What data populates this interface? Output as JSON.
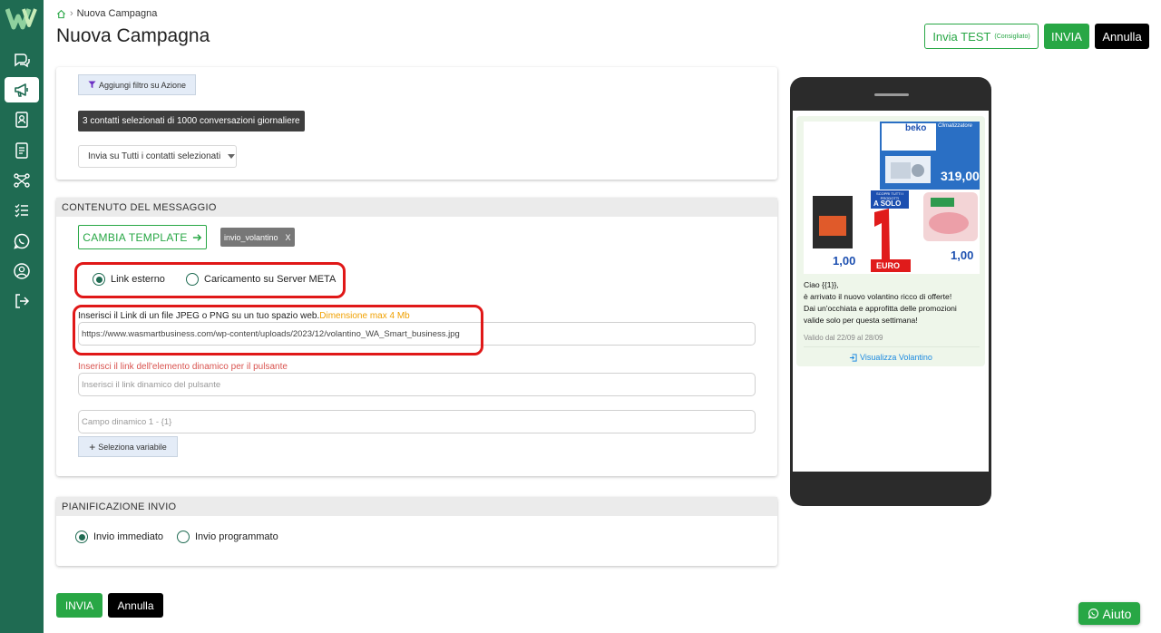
{
  "breadcrumb": {
    "current": "Nuova Campagna"
  },
  "page": {
    "title": "Nuova Campagna"
  },
  "header_actions": {
    "test_label": "Invia TEST",
    "test_hint": "(Consigliato)",
    "send_label": "INVIA",
    "cancel_label": "Annulla"
  },
  "filter_card": {
    "filter_button": "Aggiungi filtro su Azione",
    "contacts_badge": "3 contatti selezionati di 1000 conversazioni giornaliere",
    "send_select_value": "Invia su Tutti i contatti selezionati"
  },
  "content_card": {
    "heading": "CONTENUTO DEL MESSAGGIO",
    "change_template": "CAMBIA TEMPLATE",
    "template_tag": "invio_volantino",
    "template_tag_remove": "X",
    "media_options": [
      {
        "label": "Link esterno",
        "checked": true
      },
      {
        "label": "Caricamento su Server META",
        "checked": false
      }
    ],
    "link_label": "Inserisci il Link di un file JPEG o PNG su un tuo spazio web.",
    "link_hint": "Dimensione max 4 Mb",
    "link_value": "https://www.wasmartbusiness.com/wp-content/uploads/2023/12/volantino_WA_Smart_business.jpg",
    "dynamic_link_label": "Inserisci il link dell'elemento dinamico per il pulsante",
    "dynamic_link_placeholder": "Inserisci il link dinamico del pulsante",
    "dynamic_field_placeholder": "Campo dinamico 1 - {1}",
    "select_variable": "Seleziona variabile"
  },
  "plan_card": {
    "heading": "PIANIFICAZIONE INVIO",
    "options": [
      {
        "label": "Invio immediato",
        "checked": true
      },
      {
        "label": "Invio programmato",
        "checked": false
      }
    ]
  },
  "footer_actions": {
    "send_label": "INVIA",
    "cancel_label": "Annulla"
  },
  "preview": {
    "flyer": {
      "brand": "beko",
      "ac_banner": "Climatizzatore",
      "ac_price": "319,00",
      "promo_top": "SCOPRI TUTTI I PRODOTTI",
      "promo_label": "A SOLO",
      "promo_number": "1",
      "promo_unit": "EURO",
      "left_price": "1,00",
      "right_price": "1,00"
    },
    "message_lines": [
      "Ciao {{1}},",
      "è arrivato il nuovo volantino ricco di offerte!",
      "Dai un'occhiata e approfitta delle promozioni",
      "valide solo per questa settimana!"
    ],
    "validity": "Valido dal 22/09 al 28/09",
    "button_label": "Visualizza Volantino"
  },
  "help_button": "Aiuto",
  "colors": {
    "brand_green": "#1f6b52",
    "action_green": "#28a745",
    "highlight_red": "#e01818",
    "hint_orange": "#f0a000"
  }
}
